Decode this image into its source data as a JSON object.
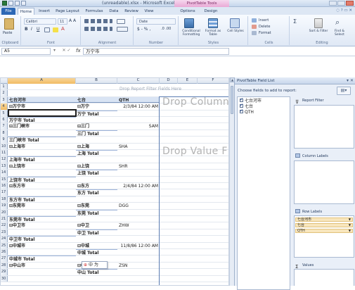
{
  "app": {
    "caption": "(unreadable).xlsx - Microsoft Excel",
    "contextual_tab": "PivotTable Tools"
  },
  "tabs": [
    "File",
    "Home",
    "Insert",
    "Page Layout",
    "Formulas",
    "Data",
    "Review",
    "View",
    "Options",
    "Design"
  ],
  "active_tab": "Home",
  "ribbon": {
    "groups": [
      "Clipboard",
      "Font",
      "Alignment",
      "Number",
      "Styles",
      "Cells",
      "Editing"
    ],
    "paste_label": "Paste",
    "font_name": "Calibri",
    "font_size": "11",
    "number_format": "Date",
    "styles": {
      "conditional": "Conditional Formatting",
      "format_table": "Format as Table",
      "cell_styles": "Cell Styles"
    },
    "cells": {
      "insert": "Insert",
      "delete": "Delete",
      "format": "Format"
    },
    "editing": {
      "sort": "Sort & Filter",
      "find": "Find & Select"
    }
  },
  "formula_bar": {
    "name_box": "A5",
    "value": "万宁市"
  },
  "sheet": {
    "columns": [
      "A",
      "B",
      "C",
      "D",
      "E",
      "F"
    ],
    "report_filter_hint": "Drop Report Filter Fields Here",
    "drop_column": "Drop Column",
    "drop_value": "Drop Value F",
    "headers": {
      "a": "七台河市",
      "b": "七台",
      "c": "QTH"
    },
    "rows": [
      {
        "n": "1"
      },
      {
        "n": "2"
      },
      {
        "n": "3",
        "a": "七台河市",
        "b": "七台",
        "c": "QTH",
        "hdr": true
      },
      {
        "n": "4",
        "a": "⊟万宁市",
        "b": "⊟万宁",
        "c": "2/3/84 12:00 AM",
        "sel": true
      },
      {
        "n": "5",
        "b": "万宁 Total",
        "btot": true
      },
      {
        "n": "6",
        "a": "万宁市 Total",
        "atot": true
      },
      {
        "n": "7",
        "a": "⊟三门峡市",
        "b": "⊟三门",
        "c": "SAM"
      },
      {
        "n": "8",
        "b": "三门 Total",
        "btot": true
      },
      {
        "n": "9",
        "a": "三门峡市 Total",
        "atot": true
      },
      {
        "n": "10",
        "a": "⊟上海市",
        "b": "⊟上海",
        "c": "SHA"
      },
      {
        "n": "11",
        "b": "上海 Total",
        "btot": true
      },
      {
        "n": "12",
        "a": "上海市 Total",
        "atot": true
      },
      {
        "n": "13",
        "a": "⊟上饶市",
        "b": "⊟上饶",
        "c": "SHR"
      },
      {
        "n": "14",
        "b": "上饶 Total",
        "btot": true
      },
      {
        "n": "15",
        "a": "上饶市 Total",
        "atot": true
      },
      {
        "n": "16",
        "a": "⊟东方市",
        "b": "⊟东方",
        "c": "2/4/84 12:00 AM"
      },
      {
        "n": "17",
        "b": "东方 Total",
        "btot": true
      },
      {
        "n": "18",
        "a": "东方市 Total",
        "atot": true
      },
      {
        "n": "19",
        "a": "⊟东莞市",
        "b": "⊟东莞",
        "c": "DGG"
      },
      {
        "n": "20",
        "b": "东莞 Total",
        "btot": true
      },
      {
        "n": "21",
        "a": "东莞市 Total",
        "atot": true
      },
      {
        "n": "22",
        "a": "⊟中卫市",
        "b": "⊟中卫",
        "c": "ZHW"
      },
      {
        "n": "23",
        "b": "中卫 Total",
        "btot": true
      },
      {
        "n": "24",
        "a": "中卫市 Total",
        "atot": true
      },
      {
        "n": "25",
        "a": "⊟中城市",
        "b": "⊟中城",
        "c": "11/8/86 12:00 AM"
      },
      {
        "n": "26",
        "b": "中城 Total",
        "btot": true
      },
      {
        "n": "27",
        "a": "中城市 Total",
        "atot": true
      },
      {
        "n": "28",
        "a": "⊟中山市",
        "b": "⊟中山",
        "c": "ZSN"
      },
      {
        "n": "29",
        "b": "中山 Total",
        "btot": true
      },
      {
        "n": "30"
      }
    ],
    "paste_tag": "中 为"
  },
  "field_list": {
    "title": "PivotTable Field List",
    "choose_label": "Choose fields to add to report:",
    "fields": [
      {
        "label": "七台河市",
        "checked": true
      },
      {
        "label": "七台",
        "checked": true
      },
      {
        "label": "QTH",
        "checked": true
      }
    ],
    "areas": {
      "report_filter": "Report Filter",
      "column_labels": "Column Labels",
      "row_labels": "Row Labels",
      "values": "Values"
    },
    "row_items": [
      "七台河市",
      "七台",
      "QTH"
    ]
  },
  "colors": {
    "accent": "#2d68b5",
    "contextual": "#e9a9d6",
    "header_fill": "#d9e4f4"
  }
}
